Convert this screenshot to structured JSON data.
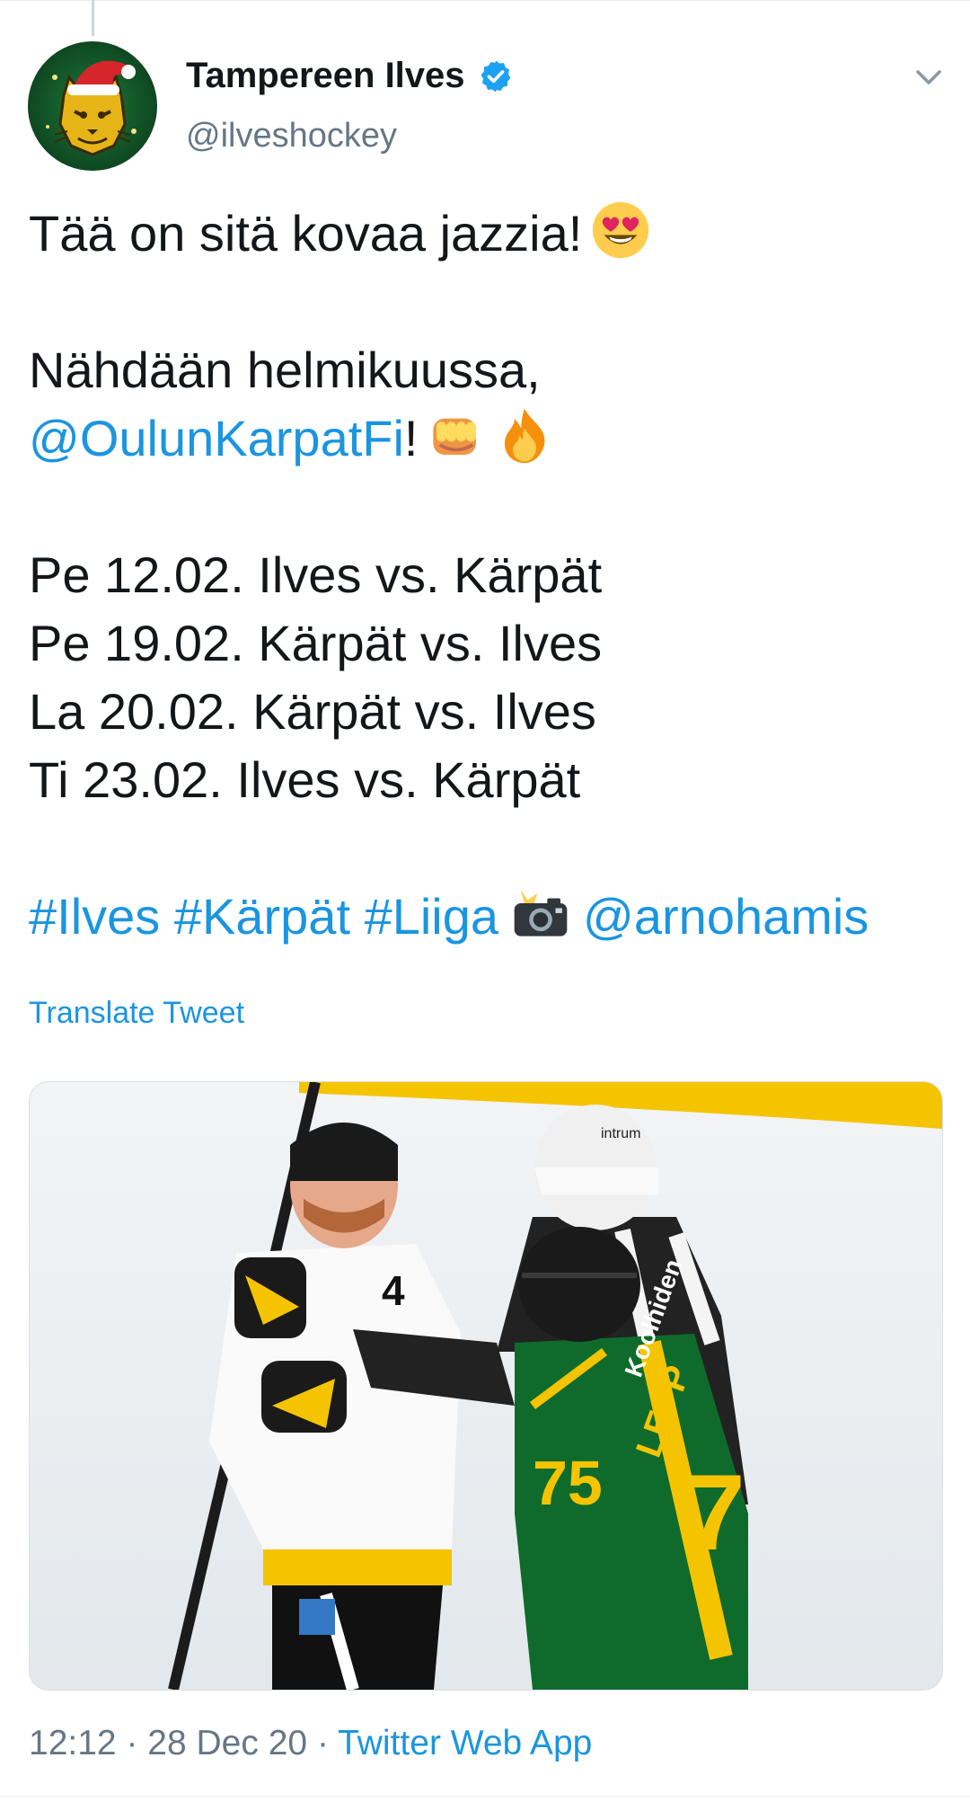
{
  "author": {
    "name": "Tampereen Ilves",
    "handle": "@ilveshockey",
    "verified": true,
    "avatar_icon": "lynx-christmas-hat-avatar"
  },
  "tweet": {
    "line1": "Tää on sitä kovaa jazzia!",
    "line2": "Nähdään helmikuussa,",
    "mention_karpat": "@OulunKarpatFi",
    "mention_suffix": "!",
    "schedule": [
      "Pe 12.02. Ilves vs. Kärpät",
      "Pe 19.02. Kärpät vs. Ilves",
      "La 20.02. Kärpät vs. Ilves",
      "Ti 23.02. Ilves vs. Kärpät"
    ],
    "hashtags": [
      "#Ilves",
      "#Kärpät",
      "#Liiga"
    ],
    "photo_credit": "@arnohamis",
    "emojis": [
      "smiling-face-with-heart-eyes",
      "oncoming-fist",
      "fire",
      "camera-with-flash"
    ]
  },
  "translate_label": "Translate Tweet",
  "photo": {
    "jersey_number": "75",
    "player_name": "LEPP",
    "sponsor": "Koolhiden",
    "helmet_brand": "intrum"
  },
  "meta": {
    "time": "12:12",
    "separator": "·",
    "date": "28 Dec 20",
    "source": "Twitter Web App"
  },
  "colors": {
    "link": "#1b95e0",
    "text": "#14171a",
    "muted": "#657786",
    "ilves_green": "#0f6b2c",
    "karpat_yellow": "#f5c400"
  }
}
